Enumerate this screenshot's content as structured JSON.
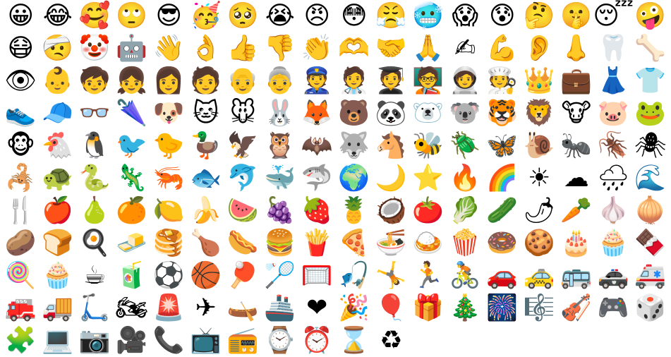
{
  "emoji_grid": {
    "rows": [
      [
        {
          "name": "grinning-face",
          "char": "😀"
        },
        {
          "name": "face-with-tears-of-joy",
          "char": "😂"
        },
        {
          "name": "smiling-face-with-hearts",
          "char": "🥰"
        },
        {
          "name": "face-with-rolling-eyes",
          "char": "🙄"
        },
        {
          "name": "smiling-face-with-sunglasses",
          "char": "😎"
        },
        {
          "name": "partying-face",
          "char": "🥳"
        },
        {
          "name": "pleading-face",
          "char": "🥺"
        },
        {
          "name": "loudly-crying-face",
          "char": "😭"
        },
        {
          "name": "angry-face",
          "char": "😠"
        },
        {
          "name": "flushed-face",
          "char": "😳"
        },
        {
          "name": "face-with-steam",
          "char": "😤"
        },
        {
          "name": "cold-face",
          "char": "🥶"
        },
        {
          "name": "face-screaming-in-fear",
          "char": "😱"
        },
        {
          "name": "anxious-face-with-sweat",
          "char": "😰"
        },
        {
          "name": "thinking-face",
          "char": "🤔"
        },
        {
          "name": "shushing-face",
          "char": "🤫"
        },
        {
          "name": "sleeping-face",
          "char": "😴"
        },
        {
          "name": "zany-face",
          "char": "🤪"
        }
      ],
      [
        {
          "name": "face-with-medical-mask",
          "char": "😷"
        },
        {
          "name": "face-with-head-bandage",
          "char": "🤕"
        },
        {
          "name": "clown-face",
          "char": "🤡"
        },
        {
          "name": "robot",
          "char": "🤖"
        },
        {
          "name": "waving-hand",
          "char": "👋"
        },
        {
          "name": "ok-hand",
          "char": "👌"
        },
        {
          "name": "thumbs-up",
          "char": "👍"
        },
        {
          "name": "thumbs-down",
          "char": "👎"
        },
        {
          "name": "clapping-hands",
          "char": "👏"
        },
        {
          "name": "heart-hands",
          "char": "🫶"
        },
        {
          "name": "handshake",
          "char": "🤝"
        },
        {
          "name": "folded-hands",
          "char": "🙏"
        },
        {
          "name": "writing-hand",
          "char": "✍"
        },
        {
          "name": "flexed-biceps",
          "char": "💪"
        },
        {
          "name": "ear",
          "char": "👂"
        },
        {
          "name": "nose",
          "char": "👃"
        },
        {
          "name": "tooth",
          "char": "🦷"
        },
        {
          "name": "bone",
          "char": "🦴"
        }
      ],
      [
        {
          "name": "eye",
          "char": "👁"
        },
        {
          "name": "baby",
          "char": "👶"
        },
        {
          "name": "child",
          "char": "🧒"
        },
        {
          "name": "girl",
          "char": "👧"
        },
        {
          "name": "woman",
          "char": "👩"
        },
        {
          "name": "person",
          "char": "🧑"
        },
        {
          "name": "old-man",
          "char": "👴"
        },
        {
          "name": "old-woman",
          "char": "👵"
        },
        {
          "name": "police-officer",
          "char": "👮"
        },
        {
          "name": "health-worker",
          "char": "🧑‍⚕️"
        },
        {
          "name": "student",
          "char": "🧑‍🎓"
        },
        {
          "name": "teacher",
          "char": "🧑‍🏫"
        },
        {
          "name": "astronaut",
          "char": "🧑‍🚀"
        },
        {
          "name": "cook",
          "char": "🧑‍🍳"
        },
        {
          "name": "crown",
          "char": "👑"
        },
        {
          "name": "briefcase",
          "char": "💼"
        },
        {
          "name": "dress",
          "char": "👗"
        },
        {
          "name": "t-shirt",
          "char": "👕"
        }
      ],
      [
        {
          "name": "running-shoe",
          "char": "👟"
        },
        {
          "name": "billed-cap",
          "char": "🧢"
        },
        {
          "name": "glasses",
          "char": "👓"
        },
        {
          "name": "closed-umbrella",
          "char": "🌂"
        },
        {
          "name": "dog-face",
          "char": "🐶"
        },
        {
          "name": "cat-face",
          "char": "🐱"
        },
        {
          "name": "mouse-face",
          "char": "🐭"
        },
        {
          "name": "rabbit-face",
          "char": "🐰"
        },
        {
          "name": "fox",
          "char": "🦊"
        },
        {
          "name": "bear",
          "char": "🐻"
        },
        {
          "name": "panda",
          "char": "🐼"
        },
        {
          "name": "polar-bear",
          "char": "🐻‍❄️"
        },
        {
          "name": "koala",
          "char": "🐨"
        },
        {
          "name": "tiger-face",
          "char": "🐯"
        },
        {
          "name": "lion",
          "char": "🦁"
        },
        {
          "name": "cow-face",
          "char": "🐮"
        },
        {
          "name": "pig-face",
          "char": "🐷"
        },
        {
          "name": "frog",
          "char": "🐸"
        }
      ],
      [
        {
          "name": "monkey-face",
          "char": "🐵"
        },
        {
          "name": "chicken",
          "char": "🐔"
        },
        {
          "name": "penguin",
          "char": "🐧"
        },
        {
          "name": "bird",
          "char": "🐦"
        },
        {
          "name": "baby-chick",
          "char": "🐤"
        },
        {
          "name": "duck",
          "char": "🦆"
        },
        {
          "name": "eagle",
          "char": "🦅"
        },
        {
          "name": "owl",
          "char": "🦉"
        },
        {
          "name": "bat",
          "char": "🦇"
        },
        {
          "name": "wolf",
          "char": "🐺"
        },
        {
          "name": "horse-face",
          "char": "🐴"
        },
        {
          "name": "honeybee",
          "char": "🐝"
        },
        {
          "name": "beetle",
          "char": "🪲"
        },
        {
          "name": "butterfly",
          "char": "🦋"
        },
        {
          "name": "snail",
          "char": "🐌"
        },
        {
          "name": "ant",
          "char": "🐜"
        },
        {
          "name": "cockroach",
          "char": "🪳"
        },
        {
          "name": "spider",
          "char": "🕷"
        }
      ],
      [
        {
          "name": "scorpion",
          "char": "🦂"
        },
        {
          "name": "turtle",
          "char": "🐢"
        },
        {
          "name": "snake",
          "char": "🐍"
        },
        {
          "name": "lizard",
          "char": "🦎"
        },
        {
          "name": "shrimp",
          "char": "🦐"
        },
        {
          "name": "fish",
          "char": "🐟"
        },
        {
          "name": "dolphin",
          "char": "🐬"
        },
        {
          "name": "whale",
          "char": "🐳"
        },
        {
          "name": "shark",
          "char": "🦈"
        },
        {
          "name": "globe",
          "char": "🌍"
        },
        {
          "name": "crescent-moon",
          "char": "🌙"
        },
        {
          "name": "star",
          "char": "⭐"
        },
        {
          "name": "fire",
          "char": "🔥"
        },
        {
          "name": "rainbow",
          "char": "🌈"
        },
        {
          "name": "sun",
          "char": "☀"
        },
        {
          "name": "cloud",
          "char": "☁"
        },
        {
          "name": "cloud-with-rain",
          "char": "🌧"
        },
        {
          "name": "water-wave",
          "char": "🌊"
        }
      ],
      [
        {
          "name": "fork-and-knife",
          "char": "🍴"
        },
        {
          "name": "red-apple",
          "char": "🍎"
        },
        {
          "name": "pear",
          "char": "🍐"
        },
        {
          "name": "tangerine",
          "char": "🍊"
        },
        {
          "name": "lemon",
          "char": "🍋"
        },
        {
          "name": "banana",
          "char": "🍌"
        },
        {
          "name": "watermelon",
          "char": "🍉"
        },
        {
          "name": "grapes",
          "char": "🍇"
        },
        {
          "name": "strawberry",
          "char": "🍓"
        },
        {
          "name": "pineapple",
          "char": "🍍"
        },
        {
          "name": "coconut",
          "char": "🥥"
        },
        {
          "name": "tomato",
          "char": "🍅"
        },
        {
          "name": "leafy-green",
          "char": "🥬"
        },
        {
          "name": "cucumber",
          "char": "🥒"
        },
        {
          "name": "hot-pepper",
          "char": "🌶"
        },
        {
          "name": "carrot",
          "char": "🥕"
        },
        {
          "name": "garlic",
          "char": "🧄"
        },
        {
          "name": "onion",
          "char": "🧅"
        }
      ],
      [
        {
          "name": "potato",
          "char": "🥔"
        },
        {
          "name": "bread",
          "char": "🍞"
        },
        {
          "name": "cooking",
          "char": "🍳"
        },
        {
          "name": "butter",
          "char": "🧈"
        },
        {
          "name": "pancakes",
          "char": "🥞"
        },
        {
          "name": "poultry-leg",
          "char": "🍗"
        },
        {
          "name": "hot-dog",
          "char": "🌭"
        },
        {
          "name": "hamburger",
          "char": "🍔"
        },
        {
          "name": "french-fries",
          "char": "🍟"
        },
        {
          "name": "pizza",
          "char": "🍕"
        },
        {
          "name": "steaming-bowl",
          "char": "🍜"
        },
        {
          "name": "curry-rice",
          "char": "🍛"
        },
        {
          "name": "popcorn",
          "char": "🍿"
        },
        {
          "name": "doughnut",
          "char": "🍩"
        },
        {
          "name": "cookie",
          "char": "🍪"
        },
        {
          "name": "birthday-cake",
          "char": "🎂"
        },
        {
          "name": "cupcake",
          "char": "🧁"
        },
        {
          "name": "chocolate-bar",
          "char": "🍫"
        }
      ],
      [
        {
          "name": "lollipop",
          "char": "🍭"
        },
        {
          "name": "muffin",
          "char": "🧁"
        },
        {
          "name": "hot-beverage",
          "char": "☕"
        },
        {
          "name": "beverage-box",
          "char": "🧃"
        },
        {
          "name": "soccer-ball",
          "char": "⚽"
        },
        {
          "name": "basketball",
          "char": "🏀"
        },
        {
          "name": "ping-pong",
          "char": "🏓"
        },
        {
          "name": "badminton",
          "char": "🏸"
        },
        {
          "name": "goal-net",
          "char": "🥅"
        },
        {
          "name": "fishing-pole",
          "char": "🎣"
        },
        {
          "name": "person-cartwheeling",
          "char": "🤸"
        },
        {
          "name": "person-running",
          "char": "🏃"
        },
        {
          "name": "person-biking",
          "char": "🚴"
        },
        {
          "name": "automobile",
          "char": "🚗"
        },
        {
          "name": "taxi",
          "char": "🚕"
        },
        {
          "name": "bus",
          "char": "🚌"
        },
        {
          "name": "police-car",
          "char": "🚓"
        },
        {
          "name": "ambulance",
          "char": "🚑"
        }
      ],
      [
        {
          "name": "fire-engine",
          "char": "🚒"
        },
        {
          "name": "delivery-truck",
          "char": "🚚"
        },
        {
          "name": "kick-scooter",
          "char": "🛴"
        },
        {
          "name": "motorcycle",
          "char": "🏍"
        },
        {
          "name": "police-car-light",
          "char": "🚨"
        },
        {
          "name": "airplane",
          "char": "✈"
        },
        {
          "name": "canoe",
          "char": "🛶"
        },
        {
          "name": "ship",
          "char": "🚢"
        },
        {
          "name": "red-heart",
          "char": "❤"
        },
        {
          "name": "party-popper",
          "char": "🎉"
        },
        {
          "name": "balloon",
          "char": "🎈"
        },
        {
          "name": "wrapped-gift",
          "char": "🎁"
        },
        {
          "name": "christmas-tree",
          "char": "🎄"
        },
        {
          "name": "fireworks",
          "char": "🎆"
        },
        {
          "name": "musical-score",
          "char": "🎼"
        },
        {
          "name": "violin",
          "char": "🎻"
        },
        {
          "name": "video-game",
          "char": "🎮"
        },
        {
          "name": "game-die",
          "char": "🎲"
        }
      ],
      [
        {
          "name": "puzzle-piece",
          "char": "🧩"
        },
        {
          "name": "laptop",
          "char": "💻"
        },
        {
          "name": "camera",
          "char": "📷"
        },
        {
          "name": "movie-camera",
          "char": "🎥"
        },
        {
          "name": "telephone-receiver",
          "char": "📞"
        },
        {
          "name": "television",
          "char": "📺"
        },
        {
          "name": "radio",
          "char": "📻"
        },
        {
          "name": "watch",
          "char": "⌚"
        },
        {
          "name": "alarm-clock",
          "char": "⏰"
        },
        {
          "name": "hourglass",
          "char": "⌛"
        },
        {
          "name": "recycling-symbol",
          "char": "♻"
        }
      ]
    ]
  }
}
